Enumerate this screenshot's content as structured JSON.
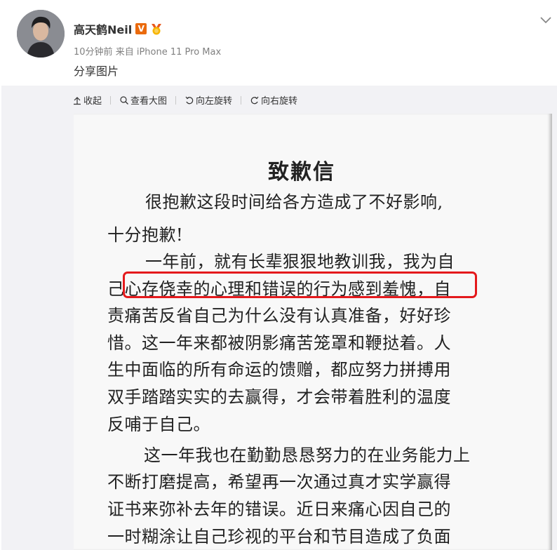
{
  "user": {
    "name": "高天鹤Neil",
    "verified_badge": "V",
    "time": "10分钟前",
    "source_prefix": "来自",
    "source_device": "iPhone 11 Pro Max",
    "post_text": "分享图片"
  },
  "toolbar": {
    "collapse": "收起",
    "view_large": "查看大图",
    "rotate_left": "向左旋转",
    "rotate_right": "向右旋转"
  },
  "letter": {
    "title": "致歉信",
    "lines": [
      "很抱歉这段时间给各方造成了不好影响,",
      "十分抱歉!",
      "一年前，就有长辈狠狠地教训我，我为自",
      "己心存侥幸的心理和错误的行为感到羞愧，自",
      "责痛苦反省自己为什么没有认真准备，好好珍",
      "惜。这一年来都被阴影痛苦笼罩和鞭挞着。人",
      "生中面临的所有命运的馈赠，都应努力拼搏用",
      "双手踏踏实实的去赢得，才会带着胜利的温度",
      "反哺于自己。",
      "这一年我也在勤勤恳恳努力的在业务能力上",
      "不断打磨提高，希望再一次通过真才实学赢得",
      "证书来弥补去年的错误。近日来痛心因自己的",
      "一时糊涂让自己珍视的平台和节目造成了负面"
    ]
  },
  "colors": {
    "highlight": "#e4191c",
    "badge": "#ea6a0d"
  }
}
